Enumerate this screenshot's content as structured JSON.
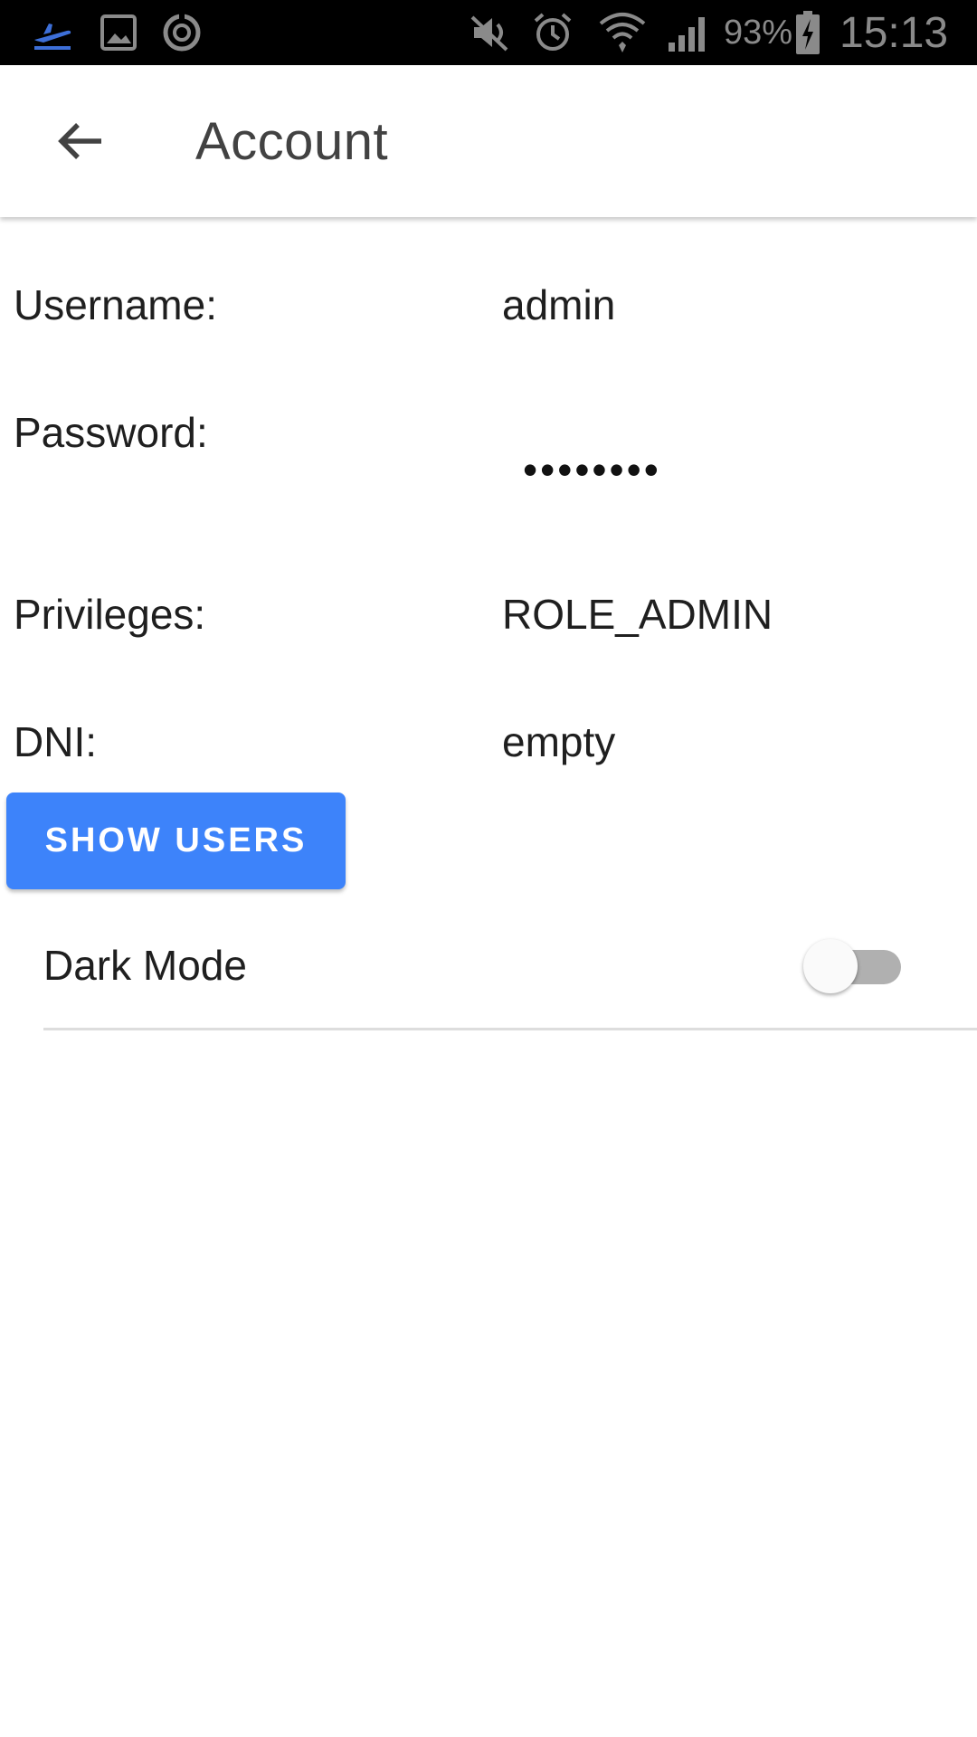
{
  "status_bar": {
    "battery_percent": "93%",
    "time": "15:13",
    "icons": [
      "airplane-departure-icon",
      "image-icon",
      "sync-icon",
      "muted-speaker-icon",
      "alarm-icon",
      "wifi-icon",
      "cell-signal-icon",
      "battery-charging-icon"
    ]
  },
  "app_bar": {
    "title": "Account",
    "back_icon": "arrow-back-icon"
  },
  "account": {
    "username_label": "Username:",
    "username_value": "admin",
    "password_label": "Password:",
    "password_value": "••••••••",
    "privileges_label": "Privileges:",
    "privileges_value": "ROLE_ADMIN",
    "dni_label": "DNI:",
    "dni_value": "empty"
  },
  "actions": {
    "show_users_label": "SHOW USERS"
  },
  "settings": {
    "dark_mode_label": "Dark Mode",
    "dark_mode_enabled": false
  },
  "colors": {
    "accent": "#3d83fa",
    "status_bar_bg": "#000000",
    "status_icon_accent": "#3d6fd8"
  }
}
